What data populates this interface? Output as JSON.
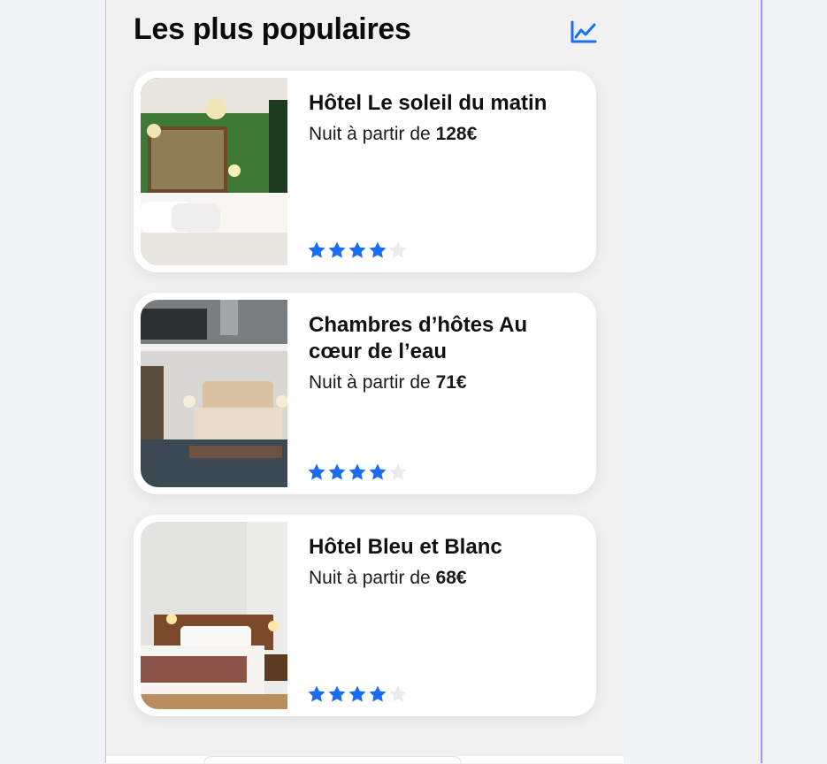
{
  "section": {
    "title": "Les plus populaires",
    "icon": "trending-chart-icon"
  },
  "colors": {
    "accent": "#1a6cf0",
    "star_empty": "#eaeaef"
  },
  "hotels": [
    {
      "name": "Hôtel Le soleil du matin",
      "price_prefix": "Nuit à partir de ",
      "price": "128€",
      "rating": 4,
      "rating_max": 5,
      "photo": "green-hotel-room-photo"
    },
    {
      "name": "Chambres d’hôtes Au cœur de l’eau",
      "price_prefix": "Nuit à partir de ",
      "price": "71€",
      "rating": 4,
      "rating_max": 5,
      "photo": "loft-bedroom-photo"
    },
    {
      "name": "Hôtel Bleu et Blanc",
      "price_prefix": "Nuit à partir de ",
      "price": "68€",
      "rating": 4,
      "rating_max": 5,
      "photo": "classic-hotel-room-photo"
    }
  ]
}
